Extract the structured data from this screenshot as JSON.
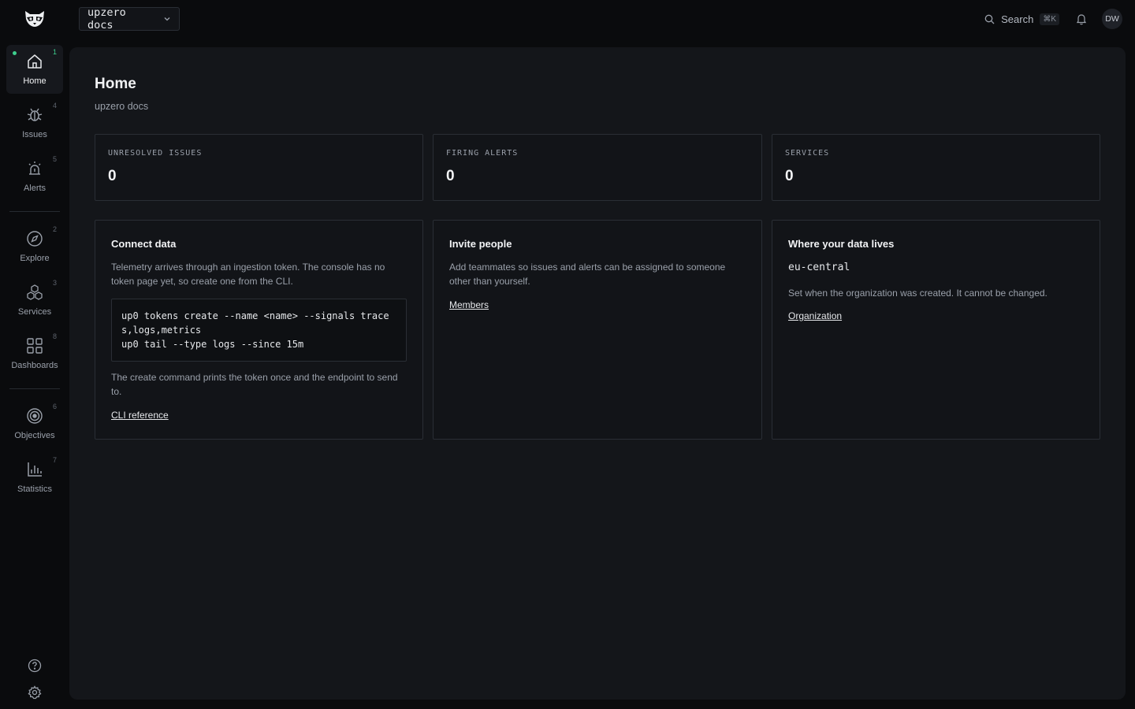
{
  "topbar": {
    "logo": "raccoon-logo",
    "workspace": "upzero docs",
    "search_label": "Search",
    "search_shortcut": "⌘K",
    "avatar_initials": "DW"
  },
  "sidebar": {
    "items": [
      {
        "label": "Home",
        "count": "1",
        "icon": "home-icon"
      },
      {
        "label": "Issues",
        "count": "4",
        "icon": "bug-icon"
      },
      {
        "label": "Alerts",
        "count": "5",
        "icon": "alarm-icon"
      },
      {
        "label": "Explore",
        "count": "2",
        "icon": "compass-icon"
      },
      {
        "label": "Services",
        "count": "3",
        "icon": "cubes-icon"
      },
      {
        "label": "Dashboards",
        "count": "8",
        "icon": "grid-icon"
      },
      {
        "label": "Objectives",
        "count": "6",
        "icon": "target-icon"
      },
      {
        "label": "Statistics",
        "count": "7",
        "icon": "bar-chart-icon"
      }
    ],
    "help_icon": "help-icon",
    "settings_icon": "gear-icon"
  },
  "main": {
    "title": "Home",
    "subtitle": "upzero docs",
    "stats": [
      {
        "label": "UNRESOLVED ISSUES",
        "value": "0"
      },
      {
        "label": "FIRING ALERTS",
        "value": "0"
      },
      {
        "label": "SERVICES",
        "value": "0"
      }
    ],
    "connect": {
      "title": "Connect data",
      "text1": "Telemetry arrives through an ingestion token. The console has no",
      "text2": "token page yet, so create one from the CLI.",
      "code_line1": "up0 tokens create --name <name> --signals trace",
      "code_line2": "s,logs,metrics",
      "code_line3": "up0 tail --type logs --since 15m",
      "after1": "The create command prints the token once and the endpoint to send",
      "after2": "to.",
      "link": "CLI reference"
    },
    "invite": {
      "title": "Invite people",
      "text1": "Add teammates so issues and alerts can be assigned to someone",
      "text2": "other than yourself.",
      "link": "Members"
    },
    "region": {
      "title": "Where your data lives",
      "value": "eu-central",
      "text": "Set when the organization was created. It cannot be changed.",
      "link": "Organization"
    }
  },
  "colors": {
    "accent": "#3ecf8e",
    "background": "#0a0b0d",
    "panel": "#14161a",
    "border": "#2a2e35"
  }
}
